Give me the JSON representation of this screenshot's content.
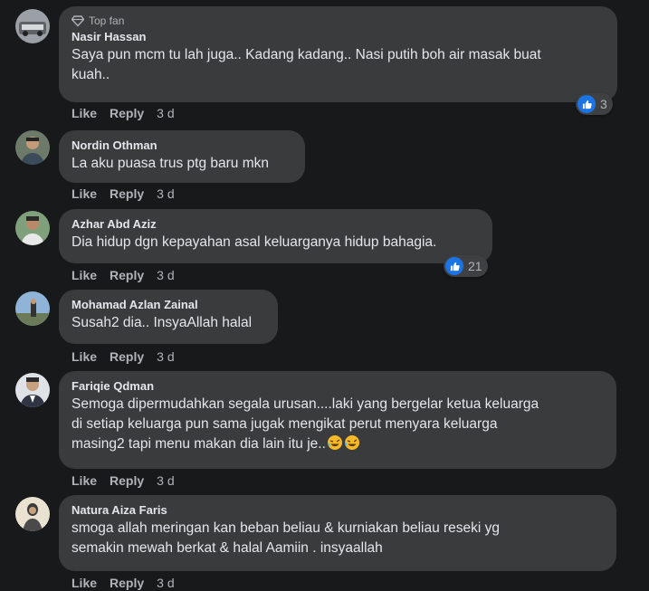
{
  "actions": {
    "like_label": "Like",
    "reply_label": "Reply"
  },
  "badge": {
    "top_fan": "Top fan"
  },
  "comments": [
    {
      "name": "Nasir Hassan",
      "top_fan": true,
      "lines": [
        "Saya pun mcm tu lah juga.. Kadang kadang.. Nasi putih boh air masak buat",
        "kuah.."
      ],
      "time": "3 d",
      "reaction_count": "3"
    },
    {
      "name": "Nordin Othman",
      "lines": [
        "La aku puasa trus ptg baru mkn"
      ],
      "time": "3 d"
    },
    {
      "name": "Azhar Abd Aziz",
      "lines": [
        "Dia hidup dgn kepayahan asal keluarganya hidup bahagia."
      ],
      "time": "3 d",
      "reaction_count": "21"
    },
    {
      "name": "Mohamad Azlan Zainal",
      "lines": [
        "Susah2 dia.. InsyaAllah halal"
      ],
      "time": "3 d"
    },
    {
      "name": "Fariqie Qdman",
      "lines": [
        "Semoga dipermudahkan segala urusan....laki yang bergelar ketua keluarga",
        "di setiap keluarga pun sama jugak mengikat perut menyara keluarga",
        "masing2 tapi menu makan dia lain itu je.."
      ],
      "time": "3 d",
      "emoji": "rolling-on-floor-laughing x2"
    },
    {
      "name": "Natura Aiza Faris",
      "lines": [
        "smoga allah meringan kan beban beliau & kurniakan beliau reseki yg",
        "semakin mewah berkat & halal Aamiin . insyaallah"
      ],
      "time": "3 d"
    }
  ],
  "colors": {
    "background": "#18191a",
    "bubble": "#3a3b3c",
    "like_blue": "#1b74e4",
    "muted": "#b0b3b8"
  }
}
